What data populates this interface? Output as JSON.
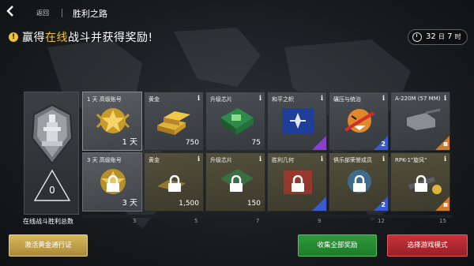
{
  "colors": {
    "accent_gold": "#f0c23a",
    "green": "#2f9a3a",
    "red": "#c8323a",
    "rarity_blue": "#3a5bd0",
    "rarity_purple": "#8a3fd0",
    "rarity_orange": "#d07a2a"
  },
  "topbar": {
    "back_label": "返回",
    "title": "胜利之路"
  },
  "header": {
    "headline_pre": "赢得",
    "headline_highlight": "在线",
    "headline_post": "战斗并获得奖励!",
    "timer_days": "32",
    "timer_days_unit": "日",
    "timer_hours": "7",
    "timer_hours_unit": "时"
  },
  "progress": {
    "wins_value": "0",
    "caption": "在线战斗胜利总数",
    "ticks": [
      "3",
      "5",
      "7",
      "9",
      "12",
      "15"
    ]
  },
  "rewards": {
    "row1": [
      {
        "title": "1 天 高级账号",
        "count": "1 天",
        "icon": "star-medal-icon"
      },
      {
        "title": "黄金",
        "count": "750",
        "icon": "gold-bars-icon"
      },
      {
        "title": "升级芯片",
        "count": "75",
        "icon": "chip-icon"
      },
      {
        "title": "和平之帜",
        "count": "",
        "icon": "flag-icon"
      },
      {
        "title": "碾压与统治",
        "count": "",
        "icon": "tiger-emblem-icon",
        "badge": "2"
      },
      {
        "title": "A-220M (57 MM)",
        "count": "",
        "icon": "cannon-module-icon",
        "badge": "III"
      }
    ],
    "row2": [
      {
        "title": "3 天 高级账号",
        "count": "3 天",
        "icon": "star-medal-icon"
      },
      {
        "title": "黄金",
        "count": "1,500",
        "icon": "gold-bars-icon"
      },
      {
        "title": "升级芯片",
        "count": "150",
        "icon": "chip-icon"
      },
      {
        "title": "胜利几何",
        "count": "",
        "icon": "decal-icon"
      },
      {
        "title": "俱乐部荣誉成员",
        "count": "",
        "icon": "club-emblem-icon",
        "badge": "2"
      },
      {
        "title": "RPK-1\"旋风\"",
        "count": "",
        "icon": "rocket-module-icon",
        "badge": "III"
      }
    ]
  },
  "buttons": {
    "activate_pass": "激活黄金通行证",
    "collect_all": "收集全部奖励",
    "select_mode": "选择游戏模式"
  }
}
